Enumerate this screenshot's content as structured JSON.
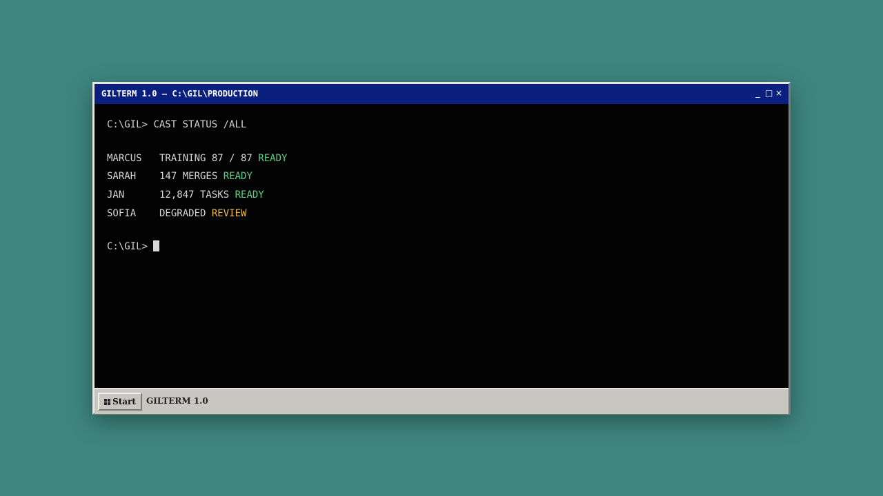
{
  "window": {
    "title": "GILTERM 1.0 — C:\\GIL\\PRODUCTION",
    "controls": {
      "minimize": "_",
      "maximize": "□",
      "close": "×"
    }
  },
  "terminal": {
    "command_prompt": "C:\\GIL>",
    "command": "CAST STATUS /ALL",
    "rows": [
      {
        "name": "MARCUS",
        "detail": "TRAINING 87 / 87",
        "status": "READY",
        "status_color": "#5fcf86"
      },
      {
        "name": "SARAH",
        "detail": "147 MERGES",
        "status": "READY",
        "status_color": "#5fcf86"
      },
      {
        "name": "JAN",
        "detail": "12,847 TASKS",
        "status": "READY",
        "status_color": "#5fcf86"
      },
      {
        "name": "SOFIA",
        "detail": "DEGRADED",
        "status": "REVIEW",
        "status_color": "#f2b84b"
      }
    ],
    "input_prompt": "C:\\GIL>",
    "input_value": ""
  },
  "taskbar": {
    "start_label": "Start",
    "task_label": "GILTERM 1.0"
  },
  "colors": {
    "desktop": "#3e857f",
    "titlebar": "#0a1f7e",
    "terminal_bg": "#030303",
    "ok": "#5fcf86",
    "warn": "#f2b84b"
  }
}
